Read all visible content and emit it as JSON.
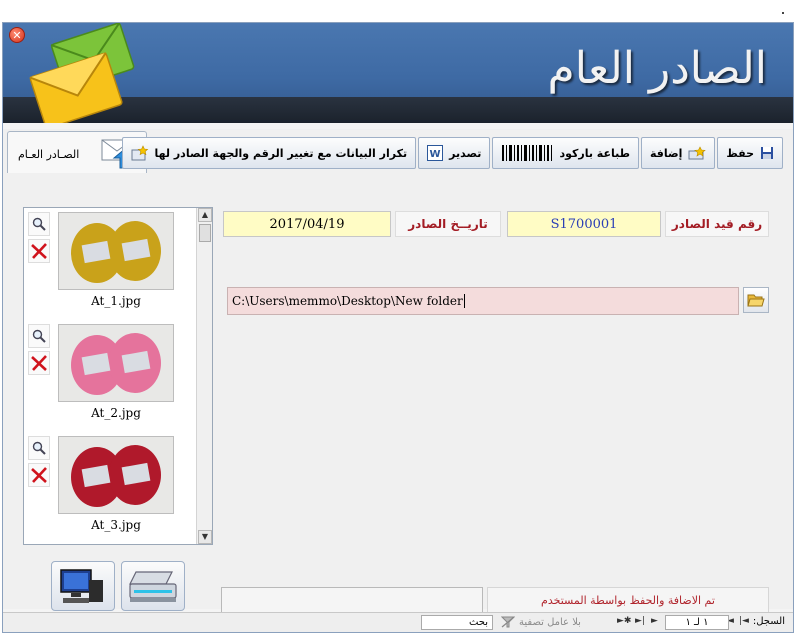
{
  "window": {
    "close_icon": "close-icon",
    "banner_title": "الصادر العام",
    "brand_colors": {
      "banner": "#3e6aa4",
      "dark_bar": "#1b222c",
      "accent_red": "#a31c24",
      "field_yellow": "#fffcc5",
      "path_pink": "#f4dcdc"
    }
  },
  "tab": {
    "label": "الصـادر العـام",
    "icon": "envelope-upload-icon"
  },
  "toolbar": {
    "save": "حفظ",
    "add": "إضافة",
    "print_barcode": "طباعة باركود",
    "export": "تصدير",
    "duplicate": "تكرار البيانات مع تغيير الرقم والجهة الصادر لها"
  },
  "form": {
    "record_number_label": "رقم قيد الصادر",
    "record_number_value": "S1700001",
    "date_label": "تاريــخ الصادر",
    "date_value": "2017/04/19",
    "path_value": "C:\\Users\\memmo\\Desktop\\New folder",
    "status_message": "تم الاضافة والحفظ بواسطة المستخدم",
    "status_empty_value": ""
  },
  "attachments": [
    {
      "caption": "At_1.jpg",
      "color": "#c9a21a"
    },
    {
      "caption": "At_2.jpg",
      "color": "#e5739c"
    },
    {
      "caption": "At_3.jpg",
      "color": "#b0192b"
    }
  ],
  "navbar": {
    "record_label": "السجل:",
    "position": "١ لـ ١",
    "no_filter": "بلا عامل تصفية",
    "search": "بحث"
  }
}
